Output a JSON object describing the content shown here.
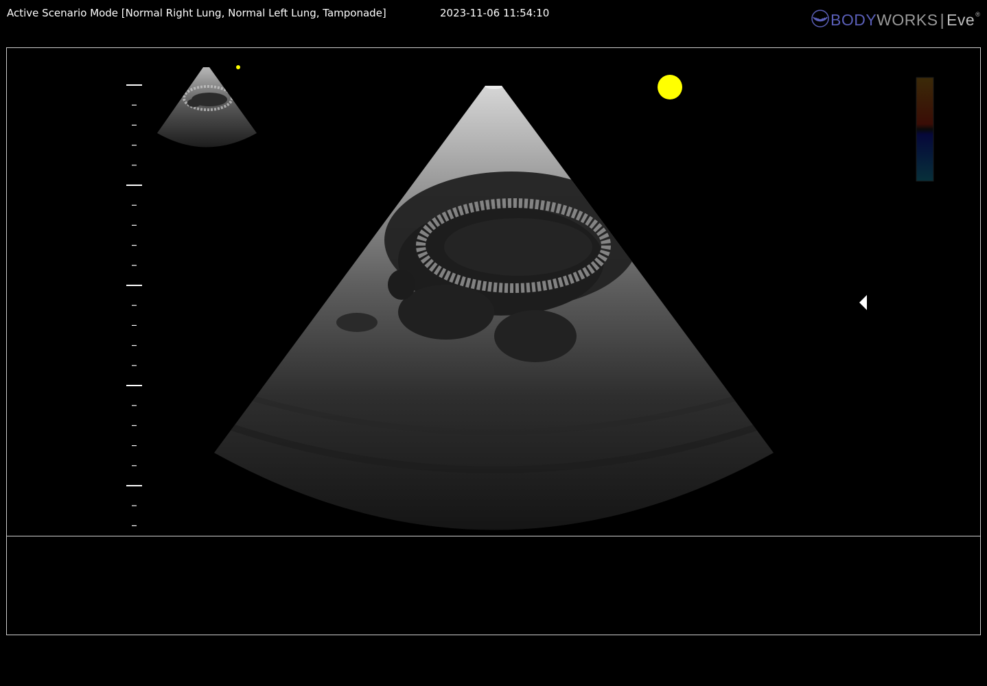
{
  "header": {
    "scenario_text": "Active Scenario Mode [Normal Right Lung, Normal Left Lung, Tamponade]",
    "timestamp": "2023-11-06 11:54:10"
  },
  "brand": {
    "part1": "BODY",
    "part2": "WORKS",
    "separator": "|",
    "product": "Eve",
    "mark": "®"
  },
  "colors": {
    "background": "#000000",
    "frame_border": "#cfcfcf",
    "brand_blue": "#5a5fb8",
    "brand_gray": "#9a9a9a",
    "indicator_yellow": "#ffff00",
    "depth_scale": "#ffffff"
  },
  "icons": {
    "brand_logo": "ultrasound-waves-icon",
    "focus_marker": "left-triangle-icon",
    "orientation_marker": "yellow-dot-icon"
  },
  "depth_scale": {
    "major_ticks": 5,
    "minor_per_major": 4
  }
}
